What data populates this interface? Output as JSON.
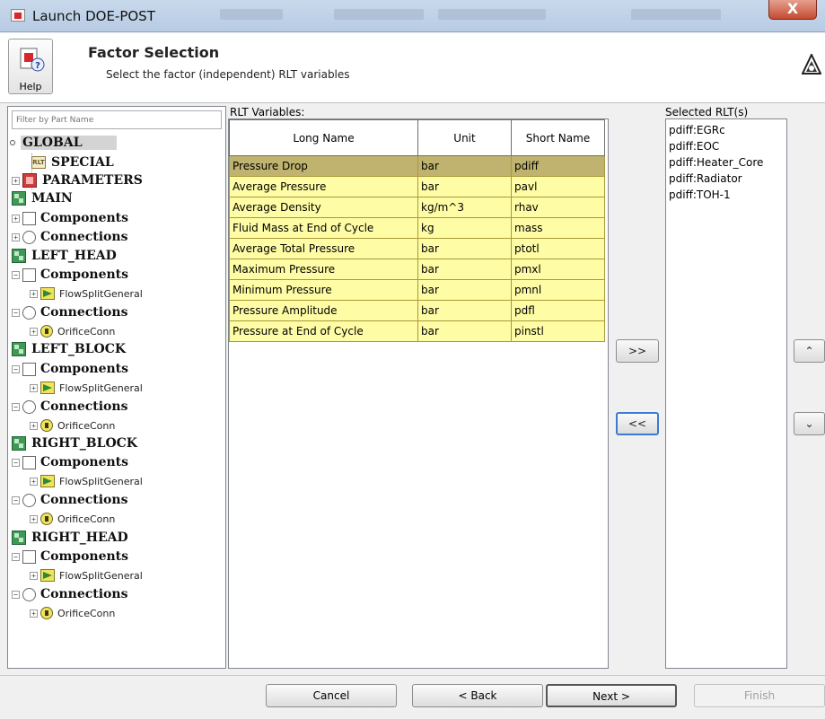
{
  "window": {
    "title": "Launch DOE-POST",
    "close_label": "X"
  },
  "header": {
    "help_label": "Help",
    "title": "Factor Selection",
    "subtitle": "Select the factor (independent) RLT variables"
  },
  "tree": {
    "filter_placeholder": "Filter by Part Name",
    "nodes": [
      {
        "label": "GLOBAL"
      },
      {
        "label": "SPECIAL"
      },
      {
        "label": "PARAMETERS"
      },
      {
        "label": "MAIN"
      },
      {
        "label": "Components"
      },
      {
        "label": "Connections"
      },
      {
        "label": "LEFT_HEAD"
      },
      {
        "label": "Components"
      },
      {
        "label": "FlowSplitGeneral"
      },
      {
        "label": "Connections"
      },
      {
        "label": "OrificeConn"
      },
      {
        "label": "LEFT_BLOCK"
      },
      {
        "label": "Components"
      },
      {
        "label": "FlowSplitGeneral"
      },
      {
        "label": "Connections"
      },
      {
        "label": "OrificeConn"
      },
      {
        "label": "RIGHT_BLOCK"
      },
      {
        "label": "Components"
      },
      {
        "label": "FlowSplitGeneral"
      },
      {
        "label": "Connections"
      },
      {
        "label": "OrificeConn"
      },
      {
        "label": "RIGHT_HEAD"
      },
      {
        "label": "Components"
      },
      {
        "label": "FlowSplitGeneral"
      },
      {
        "label": "Connections"
      },
      {
        "label": "OrificeConn"
      }
    ]
  },
  "rlt": {
    "label": "RLT Variables:",
    "columns": [
      "Long Name",
      "Unit",
      "Short Name"
    ],
    "rows": [
      [
        "Pressure Drop",
        "bar",
        "pdiff"
      ],
      [
        "Average Pressure",
        "bar",
        "pavl"
      ],
      [
        "Average Density",
        "kg/m^3",
        "rhav"
      ],
      [
        "Fluid Mass at End of Cycle",
        "kg",
        "mass"
      ],
      [
        "Average Total Pressure",
        "bar",
        "ptotl"
      ],
      [
        "Maximum Pressure",
        "bar",
        "pmxl"
      ],
      [
        "Minimum Pressure",
        "bar",
        "pmnl"
      ],
      [
        "Pressure Amplitude",
        "bar",
        "pdfl"
      ],
      [
        "Pressure at End of Cycle",
        "bar",
        "pinstl"
      ]
    ]
  },
  "move": {
    "add_label": ">>",
    "remove_label": "<<",
    "up_label": "⌃",
    "down_label": "⌄"
  },
  "selected": {
    "label": "Selected RLT(s)",
    "items": [
      "pdiff:EGRc",
      "pdiff:EOC",
      "pdiff:Heater_Core",
      "pdiff:Radiator",
      "pdiff:TOH-1"
    ]
  },
  "footer": {
    "cancel": "Cancel",
    "back": "< Back",
    "next": "Next >",
    "finish": "Finish"
  },
  "colors": {
    "row_bg": "#fefca4",
    "row_selected": "#bfb36f",
    "titlebar": "#c4d5ea"
  }
}
